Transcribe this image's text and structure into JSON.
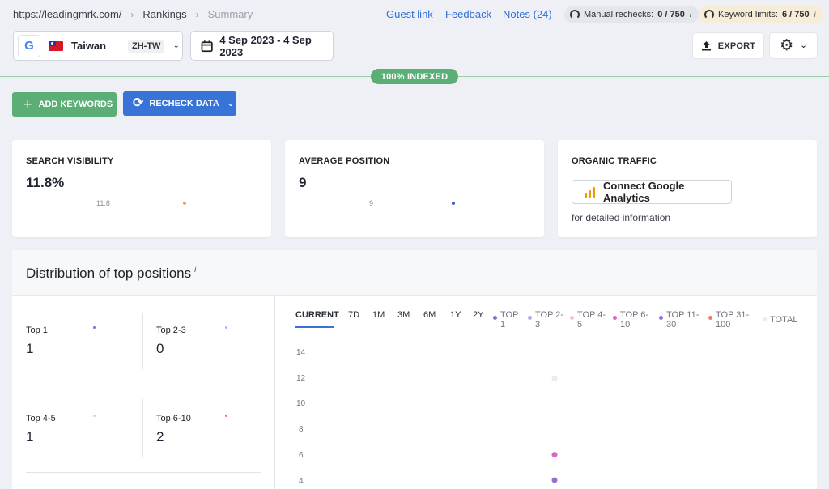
{
  "breadcrumb": {
    "site": "https://leadingmrk.com/",
    "rankings": "Rankings",
    "current": "Summary"
  },
  "header_links": {
    "guest": "Guest link",
    "feedback": "Feedback",
    "notes": "Notes (24)"
  },
  "manual_rechecks": {
    "label": "Manual rechecks:",
    "value": "0 / 750",
    "info": "i"
  },
  "keyword_limits": {
    "label": "Keyword limits:",
    "value": "6 / 750",
    "info": "i"
  },
  "location": {
    "engine_icon": "google-icon",
    "engine_letter": "G",
    "country": "Taiwan",
    "lang": "ZH-TW"
  },
  "date_range": "4 Sep 2023 - 4 Sep 2023",
  "export_label": "EXPORT",
  "indexed_badge": "100% INDEXED",
  "add_keywords": "ADD KEYWORDS",
  "recheck_data": "RECHECK DATA",
  "cards": {
    "visibility": {
      "title": "SEARCH VISIBILITY",
      "value": "11.8%",
      "spark_label": "11.8",
      "dot_color": "#f2a541"
    },
    "avg_position": {
      "title": "AVERAGE POSITION",
      "value": "9",
      "spark_label": "9",
      "dot_color": "#3b5bd6"
    },
    "traffic": {
      "title": "ORGANIC TRAFFIC",
      "connect_label": "Connect Google Analytics",
      "note": "for detailed information"
    }
  },
  "distribution": {
    "title": "Distribution of top positions",
    "info": "i",
    "stats": [
      {
        "label": "Top 1",
        "value": "1",
        "color": "#7b6fd8"
      },
      {
        "label": "Top 2-3",
        "value": "0",
        "color": "#b8a8ee"
      },
      {
        "label": "Top 4-5",
        "value": "1",
        "color": "#f3c2cc"
      },
      {
        "label": "Top 6-10",
        "value": "2",
        "color": "#d766c8"
      }
    ],
    "tabs": [
      "CURRENT",
      "7D",
      "1M",
      "3M",
      "6M",
      "1Y",
      "2Y"
    ],
    "legend": [
      {
        "line1": "TOP",
        "line2": "1",
        "color": "#7b6fd8"
      },
      {
        "line1": "TOP 2-",
        "line2": "3",
        "color": "#b8a8ee"
      },
      {
        "line1": "TOP 4-",
        "line2": "5",
        "color": "#f3c2cc"
      },
      {
        "line1": "TOP 6-",
        "line2": "10",
        "color": "#d766c8"
      },
      {
        "line1": "TOP 11-",
        "line2": "30",
        "color": "#9b6ed0"
      },
      {
        "line1": "TOP 31-",
        "line2": "100",
        "color": "#ef7b74"
      },
      {
        "line1": "TOTAL",
        "line2": "",
        "color": "#e9ebef"
      }
    ],
    "y_ticks": [
      "14",
      "12",
      "10",
      "8",
      "6",
      "4"
    ]
  },
  "chart_data": {
    "type": "scatter",
    "x": [
      "CURRENT"
    ],
    "series": [
      {
        "name": "TOTAL",
        "values": [
          12
        ],
        "color": "#e9ebef"
      },
      {
        "name": "TOP 6-10",
        "values": [
          6
        ],
        "color": "#d766c8"
      },
      {
        "name": "TOP 11-30",
        "values": [
          4
        ],
        "color": "#9b6ed0"
      }
    ],
    "y_ticks": [
      14,
      12,
      10,
      8,
      6,
      4
    ]
  }
}
